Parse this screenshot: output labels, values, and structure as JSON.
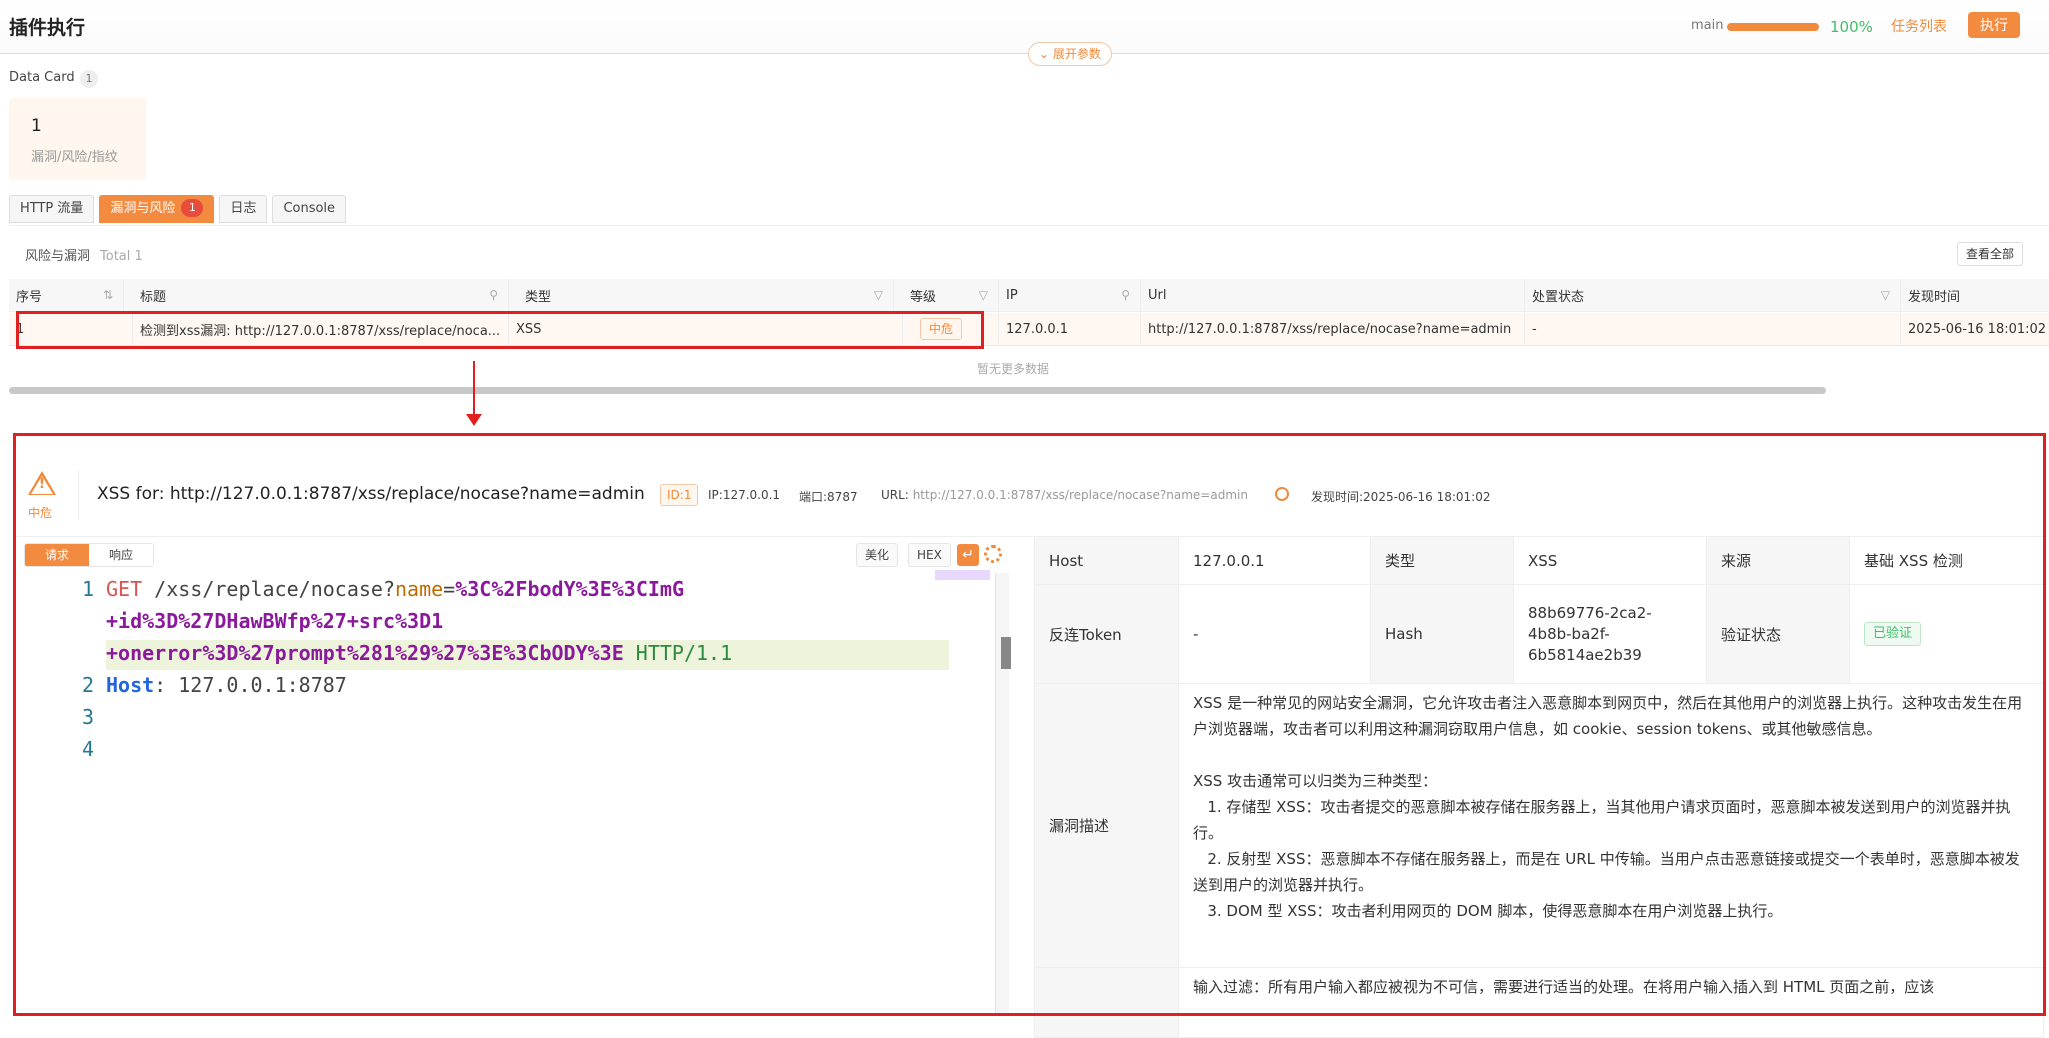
{
  "header": {
    "title": "插件执行",
    "expand_params": "展开参数",
    "branch": "main",
    "progress_pct": "100%",
    "progress_value": 1.0,
    "task_list": "任务列表",
    "run": "执行"
  },
  "data_card": {
    "label": "Data Card",
    "count": "1",
    "card_value": "1",
    "card_label": "漏洞/风险/指纹"
  },
  "tabs": [
    {
      "label": "HTTP 流量"
    },
    {
      "label": "漏洞与风险",
      "badge": "1"
    },
    {
      "label": "日志"
    },
    {
      "label": "Console"
    }
  ],
  "section": {
    "title": "风险与漏洞",
    "total": "Total 1",
    "view_all": "查看全部"
  },
  "table": {
    "columns": [
      "序号",
      "标题",
      "类型",
      "等级",
      "IP",
      "Url",
      "处置状态",
      "发现时间"
    ],
    "row": {
      "index": "1",
      "title": "检测到xss漏洞: http://127.0.0.1:8787/xss/replace/noca...",
      "type": "XSS",
      "level": "中危",
      "ip": "127.0.0.1",
      "url": "http://127.0.0.1:8787/xss/replace/nocase?name=admin",
      "status": "-",
      "time": "2025-06-16 18:01:02"
    },
    "no_more": "暂无更多数据"
  },
  "detail": {
    "severity": "中危",
    "title": "XSS for: http://127.0.0.1:8787/xss/replace/nocase?name=admin",
    "id": "ID:1",
    "ip": "IP:127.0.0.1",
    "port": "端口:8787",
    "url_label": "URL:",
    "url": "http://127.0.0.1:8787/xss/replace/nocase?name=admin",
    "found_time": "发现时间:2025-06-16 18:01:02",
    "req_tab": "请求",
    "resp_tab": "响应",
    "beautify": "美化",
    "hex": "HEX",
    "code": {
      "line_numbers": [
        "1",
        "2",
        "3",
        "4"
      ],
      "method": "GET",
      "path": " /xss/replace/nocase?",
      "param_name": "name",
      "eq": "=",
      "val1": "%3C%2FbodY%3E%3CImG",
      "val2": "+id%3D%27DHawBWfp%27+src%3D1",
      "val3": "+onerror%3D%27prompt%281%29%27%3E%3CbODY%3E",
      "proto": " HTTP/1.1",
      "host_key": "Host",
      "host_val": ": 127.0.0.1:8787"
    },
    "info": {
      "host_k": "Host",
      "host_v": "127.0.0.1",
      "type_k": "类型",
      "type_v": "XSS",
      "source_k": "来源",
      "source_v": "基础 XSS 检测",
      "token_k": "反连Token",
      "token_v": "-",
      "hash_k": "Hash",
      "hash_v": "88b69776-2ca2-\n4b8b-ba2f-\n6b5814ae2b39",
      "verify_k": "验证状态",
      "verify_v": "已验证",
      "desc_k": "漏洞描述",
      "desc_v": "XSS 是一种常见的网站安全漏洞，它允许攻击者注入恶意脚本到网页中，然后在其他用户的浏览器上执行。这种攻击发生在用户浏览器端，攻击者可以利用这种漏洞窃取用户信息，如 cookie、session tokens、或其他敏感信息。\n\nXSS 攻击通常可以归类为三种类型：\n   1. 存储型 XSS：攻击者提交的恶意脚本被存储在服务器上，当其他用户请求页面时，恶意脚本被发送到用户的浏览器并执行。\n   2. 反射型 XSS：恶意脚本不存储在服务器上，而是在 URL 中传输。当用户点击恶意链接或提交一个表单时，恶意脚本被发送到用户的浏览器并执行。\n   3. DOM 型 XSS：攻击者利用网页的 DOM 脚本，使得恶意脚本在用户浏览器上执行。",
      "fix_v": "输入过滤：所有用户输入都应被视为不可信，需要进行适当的处理。在将用户输入插入到 HTML 页面之前，应该"
    }
  }
}
